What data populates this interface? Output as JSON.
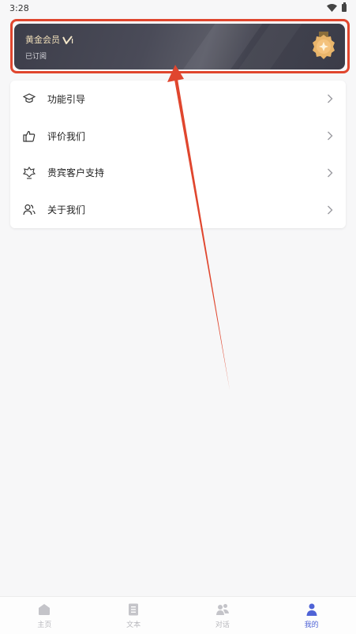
{
  "status_bar": {
    "time": "3:28"
  },
  "vip_card": {
    "title": "黄金会员",
    "status": "已订阅",
    "medal_icon": "gold-medal-icon",
    "accent": "#f1dfb9"
  },
  "menu": {
    "items": [
      {
        "label": "功能引导",
        "icon": "graduation-cap-icon"
      },
      {
        "label": "评价我们",
        "icon": "thumbs-up-icon"
      },
      {
        "label": "贵宾客户支持",
        "icon": "support-flower-icon"
      },
      {
        "label": "关于我们",
        "icon": "people-icon"
      }
    ]
  },
  "tabbar": {
    "tabs": [
      {
        "label": "主页",
        "icon": "home-icon",
        "active": false
      },
      {
        "label": "文本",
        "icon": "document-icon",
        "active": false
      },
      {
        "label": "对话",
        "icon": "chat-people-icon",
        "active": false
      },
      {
        "label": "我的",
        "icon": "profile-icon",
        "active": true
      }
    ],
    "active_color": "#4f63d6",
    "inactive_color": "#b8b8bd"
  },
  "annotation": {
    "highlight_color": "#e0462e"
  }
}
